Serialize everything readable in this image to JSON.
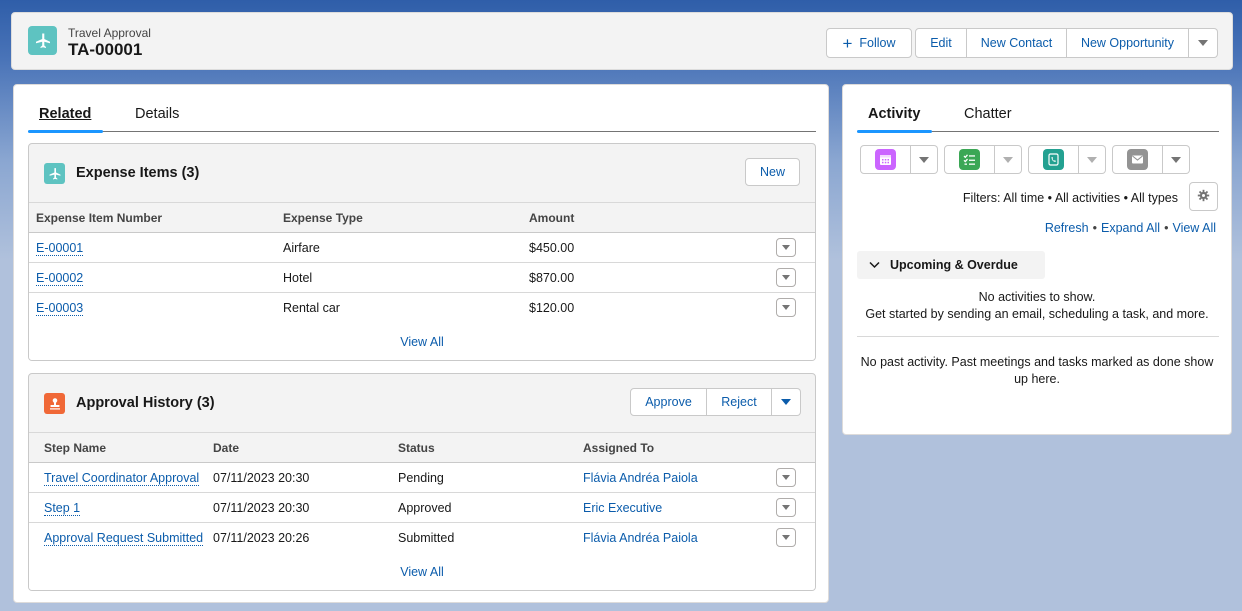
{
  "header": {
    "object_type": "Travel Approval",
    "record_name": "TA-00001",
    "icon": "airplane-icon",
    "icon_color": "#5ec3c1",
    "follow_label": "Follow",
    "actions": [
      "Edit",
      "New Contact",
      "New Opportunity"
    ]
  },
  "main": {
    "tabs": [
      {
        "label": "Related",
        "active": true
      },
      {
        "label": "Details",
        "active": false
      }
    ],
    "expense_items": {
      "title": "Expense Items (3)",
      "icon": "airplane-icon",
      "icon_color": "#5ec3c1",
      "new_label": "New",
      "columns": [
        "Expense Item Number",
        "Expense Type",
        "Amount"
      ],
      "rows": [
        {
          "number": "E-00001",
          "type": "Airfare",
          "amount": "$450.00"
        },
        {
          "number": "E-00002",
          "type": "Hotel",
          "amount": "$870.00"
        },
        {
          "number": "E-00003",
          "type": "Rental car",
          "amount": "$120.00"
        }
      ],
      "view_all": "View All"
    },
    "approval_history": {
      "title": "Approval History (3)",
      "icon": "stamp-icon",
      "icon_color": "#f06837",
      "approve_label": "Approve",
      "reject_label": "Reject",
      "columns": [
        "Step Name",
        "Date",
        "Status",
        "Assigned To"
      ],
      "rows": [
        {
          "step": "Travel Coordinator Approval",
          "date": "07/11/2023 20:30",
          "status": "Pending",
          "assigned": "Flávia Andréa Paiola"
        },
        {
          "step": "Step 1",
          "date": "07/11/2023 20:30",
          "status": "Approved",
          "assigned": "Eric Executive"
        },
        {
          "step": "Approval Request Submitted",
          "date": "07/11/2023 20:26",
          "status": "Submitted",
          "assigned": "Flávia Andréa Paiola"
        }
      ],
      "view_all": "View All"
    }
  },
  "activity": {
    "tabs": [
      {
        "label": "Activity",
        "active": true
      },
      {
        "label": "Chatter",
        "active": false
      }
    ],
    "quick_actions": [
      {
        "icon": "calendar-icon",
        "color": "#cb65ff"
      },
      {
        "icon": "task-icon",
        "color": "#3ba755"
      },
      {
        "icon": "call-icon",
        "color": "#0d9dda"
      },
      {
        "icon": "email-icon",
        "color": "#939393"
      }
    ],
    "filters_text": "Filters: All time • All activities • All types",
    "links": [
      "Refresh",
      "Expand All",
      "View All"
    ],
    "upcoming_label": "Upcoming & Overdue",
    "no_activities": "No activities to show.",
    "get_started": "Get started by sending an email, scheduling a task, and more.",
    "no_past_line1": "No past activity. Past meetings and tasks marked as done show",
    "no_past_line2": "up here."
  }
}
